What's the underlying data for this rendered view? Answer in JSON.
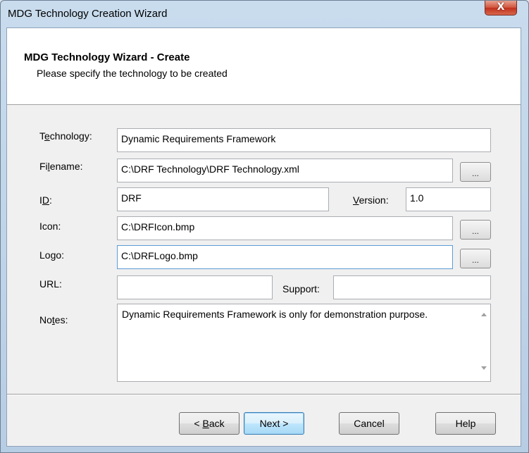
{
  "window": {
    "title": "MDG Technology Creation Wizard",
    "close_glyph": "X"
  },
  "header": {
    "title": "MDG Technology Wizard - Create",
    "subtitle": "Please specify the technology to be created"
  },
  "form": {
    "technology": {
      "label_pre": "T",
      "label_key": "e",
      "label_post": "chnology:",
      "value": "Dynamic Requirements Framework"
    },
    "filename": {
      "label_pre": "Fi",
      "label_key": "l",
      "label_post": "ename:",
      "value": "C:\\DRF Technology\\DRF Technology.xml"
    },
    "id": {
      "label_pre": "I",
      "label_key": "D",
      "label_post": ":",
      "value": "DRF"
    },
    "version": {
      "label_pre": "",
      "label_key": "V",
      "label_post": "ersion:",
      "value": "1.0"
    },
    "icon": {
      "label": "Icon:",
      "value": "C:\\DRFIcon.bmp"
    },
    "logo": {
      "label": "Logo:",
      "value": "C:\\DRFLogo.bmp"
    },
    "url": {
      "label": "URL:",
      "value": ""
    },
    "support": {
      "label": "Support:",
      "value": ""
    },
    "notes": {
      "label_pre": "No",
      "label_key": "t",
      "label_post": "es:",
      "value": "Dynamic Requirements Framework is only for demonstration purpose."
    },
    "browse_label": "..."
  },
  "buttons": {
    "back": {
      "pre": "< ",
      "key": "B",
      "post": "ack"
    },
    "next": "Next >",
    "cancel": "Cancel",
    "help": "Help"
  }
}
